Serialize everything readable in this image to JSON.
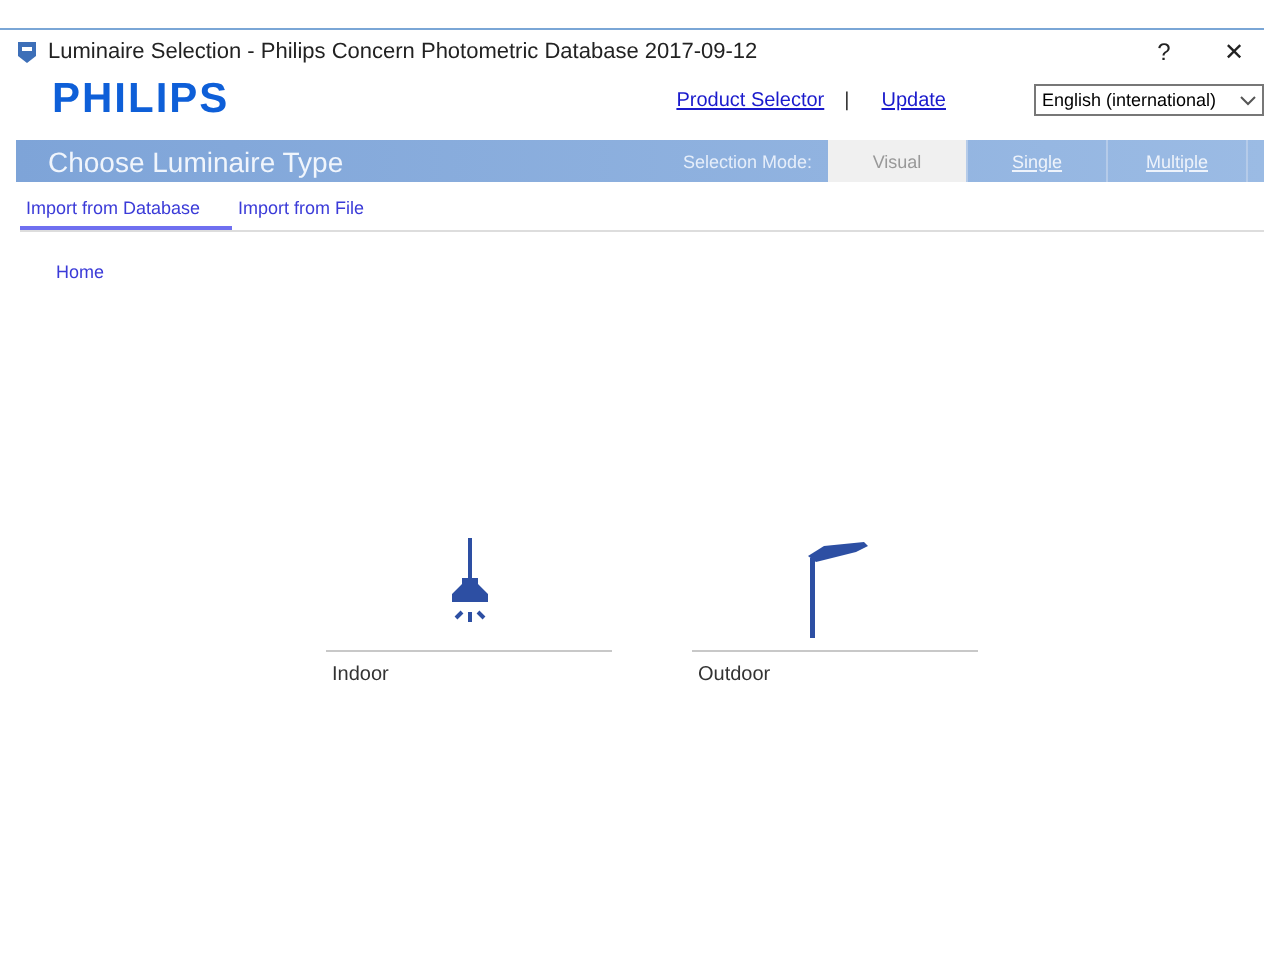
{
  "window": {
    "title": "Luminaire Selection - Philips Concern Photometric Database 2017-09-12",
    "help": "?",
    "close": "✕"
  },
  "header": {
    "logo": "PHILIPS",
    "links": [
      "Product Selector",
      "Update"
    ],
    "separator": "|",
    "language": "English (international)"
  },
  "band": {
    "title": "Choose Luminaire Type",
    "mode_label": "Selection Mode:",
    "modes": [
      {
        "label": "Visual",
        "selected": true
      },
      {
        "label": "Single",
        "selected": false
      },
      {
        "label": "Multiple",
        "selected": false
      }
    ]
  },
  "tabs": [
    {
      "label": "Import from Database",
      "selected": true
    },
    {
      "label": "Import from File",
      "selected": false
    }
  ],
  "breadcrumb": "Home",
  "categories": [
    {
      "kind": "indoor",
      "label": "Indoor"
    },
    {
      "kind": "outdoor",
      "label": "Outdoor"
    }
  ]
}
